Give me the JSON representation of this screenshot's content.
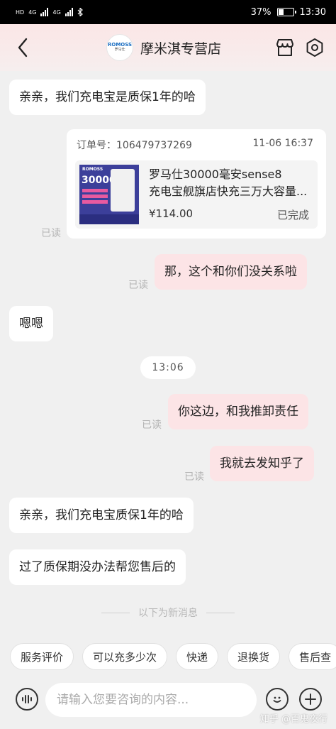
{
  "status_bar": {
    "left_tags": [
      "HD",
      "4G",
      "4G"
    ],
    "battery_pct": "37%",
    "battery_level": 0.37,
    "time": "13:30"
  },
  "header": {
    "store_logo_text": "ROMOSS",
    "store_logo_sub": "罗马仕",
    "store_name": "摩米淇专营店"
  },
  "messages": {
    "m1": "亲亲，我们充电宝是质保1年的哈",
    "order": {
      "label": "订单号：",
      "number": "106479737269",
      "time": "11-06 16:37",
      "title_line1": "罗马仕30000毫安sense8",
      "title_line2": "充电宝舰旗店快充三万大容量...",
      "price": "¥114.00",
      "status": "已完成",
      "image_brand": "ROMOSS",
      "image_big": "30000"
    },
    "read1": "已读",
    "m2": "那，这个和你们没关系啦",
    "read2": "已读",
    "m3": "嗯嗯",
    "timestamp": "13:06",
    "m4": "你这边，和我推卸责任",
    "read3": "已读",
    "m5": "我就去发知乎了",
    "read4": "已读",
    "m6": "亲亲，我们充电宝质保1年的哈",
    "m7": "过了质保期没办法帮您售后的",
    "new_divider": "以下为新消息"
  },
  "quick_replies": [
    "服务评价",
    "可以充多少次",
    "快递",
    "退换货",
    "售后查"
  ],
  "input": {
    "placeholder": "请输入您要咨询的内容..."
  },
  "watermark": "知乎 @百鬼夜行",
  "colors": {
    "outgoing_bubble": "#fce4e6",
    "incoming_bubble": "#ffffff",
    "background": "#f0f0f0"
  }
}
